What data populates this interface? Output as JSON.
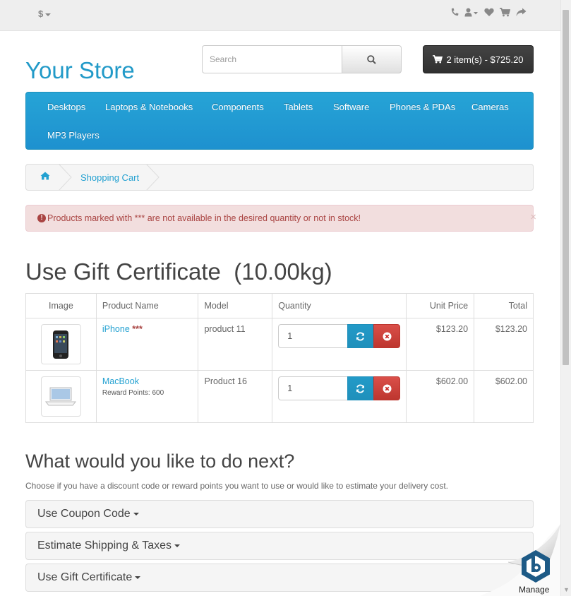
{
  "topbar": {
    "currency": "$",
    "icons": [
      "phone-icon",
      "user-icon",
      "heart-icon",
      "cart-icon",
      "share-icon"
    ]
  },
  "header": {
    "logo": "Your Store",
    "search_placeholder": "Search",
    "cart_label": "2 item(s) - $725.20"
  },
  "menu": {
    "items": [
      "Desktops",
      "Laptops & Notebooks",
      "Components",
      "Tablets",
      "Software",
      "Phones & PDAs",
      "Cameras",
      "MP3 Players"
    ]
  },
  "breadcrumb": {
    "current": "Shopping Cart"
  },
  "alert": {
    "text": "Products marked with *** are not available in the desired quantity or not in stock!",
    "close": "×"
  },
  "page_title": "Use Gift Certificate  (10.00kg)",
  "table": {
    "headers": [
      "Image",
      "Product Name",
      "Model",
      "Quantity",
      "Unit Price",
      "Total"
    ],
    "rows": [
      {
        "name": "iPhone",
        "stock_mark": "***",
        "reward": "",
        "model": "product 11",
        "quantity": "1",
        "unit_price": "$123.20",
        "total": "$123.20"
      },
      {
        "name": "MacBook",
        "stock_mark": "",
        "reward": "Reward Points: 600",
        "model": "Product 16",
        "quantity": "1",
        "unit_price": "$602.00",
        "total": "$602.00"
      }
    ]
  },
  "next": {
    "title": "What would you like to do next?",
    "description": "Choose if you have a discount code or reward points you want to use or would like to estimate your delivery cost.",
    "panels": [
      "Use Coupon Code",
      "Estimate Shipping & Taxes",
      "Use Gift Certificate"
    ]
  },
  "manage": {
    "label": "Manage"
  },
  "colors": {
    "accent": "#229ac8",
    "danger": "#a94442",
    "menu_bg": "#229ac8"
  }
}
